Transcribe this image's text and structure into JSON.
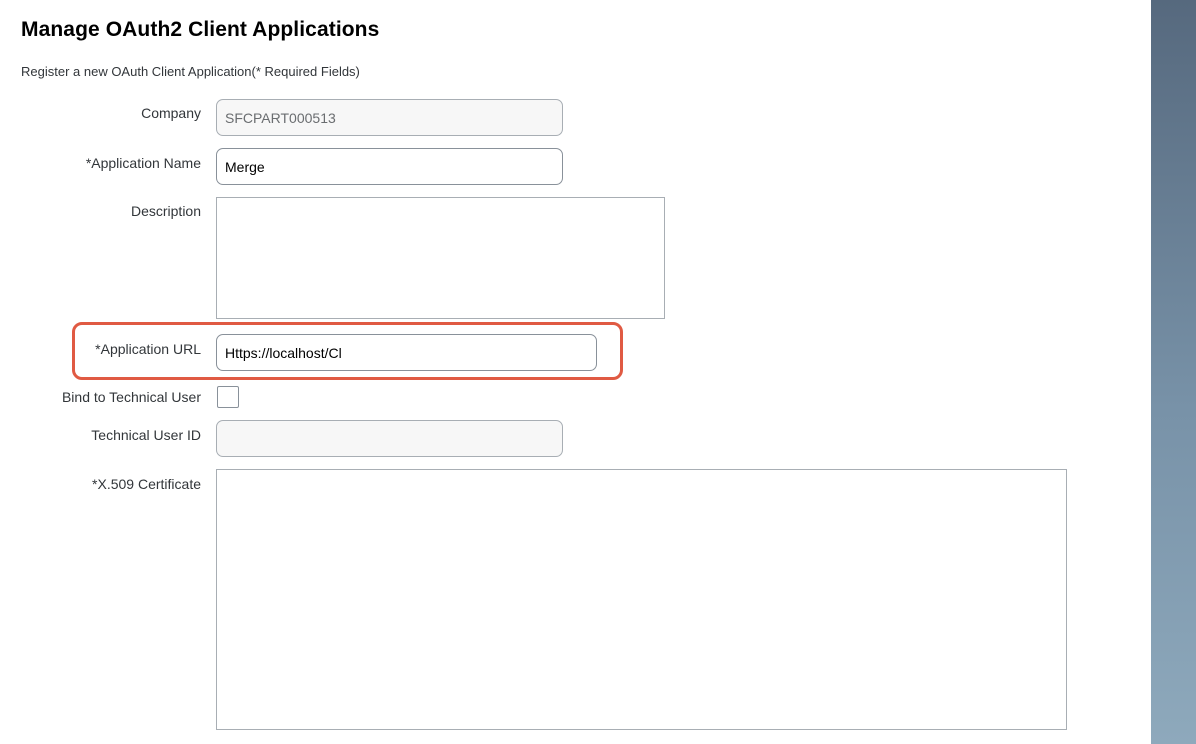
{
  "page": {
    "title": "Manage OAuth2 Client Applications",
    "subtitle": "Register a new OAuth Client Application(* Required Fields)"
  },
  "form": {
    "company": {
      "label": "Company",
      "value": "SFCPART000513"
    },
    "application_name": {
      "label": "*Application Name",
      "value": "Merge"
    },
    "description": {
      "label": "Description",
      "value": ""
    },
    "application_url": {
      "label": "*Application URL",
      "value": "Https://localhost/Cl"
    },
    "bind_technical_user": {
      "label": "Bind to Technical User",
      "checked": false
    },
    "technical_user_id": {
      "label": "Technical User ID",
      "value": ""
    },
    "certificate": {
      "label": "*X.509 Certificate",
      "value": ""
    }
  },
  "colors": {
    "highlight": "#e05a43",
    "side_panel_top": "#56697e",
    "side_panel_bottom": "#8ea9bc"
  }
}
